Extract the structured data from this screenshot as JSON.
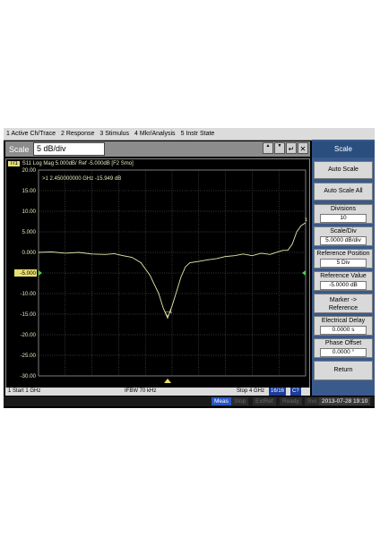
{
  "menu": [
    "1 Active Ch/Trace",
    "2 Response",
    "3 Stimulus",
    "4 Mkr/Analysis",
    "5 Instr State"
  ],
  "entry": {
    "label": "Scale",
    "value": "5 dB/div"
  },
  "entry_controls": {
    "up": "▲",
    "down": "▼",
    "enter": "↵",
    "close": "✕"
  },
  "trace": {
    "badge": "Tr1",
    "header": "S11 Log Mag 5.000dB/ Ref -5.000dB [F2 Smo]"
  },
  "marker": {
    "readout": ">1  2.450000000 GHz -15.949 dB",
    "label": "1"
  },
  "status": {
    "start": "1 Start 1 GHz",
    "ifbw": "IFBW 70 kHz",
    "stop": "Stop 4 GHz",
    "badge1": "16/16",
    "badge2": "C?"
  },
  "bottom": {
    "meas": "Meas",
    "stop": "Stop",
    "ext": "ExtRef",
    "ready": "Ready",
    "svc": "Svc",
    "time": "2013-07-28 19:10"
  },
  "softkeys": {
    "title": "Scale",
    "auto_scale": "Auto Scale",
    "auto_scale_all": "Auto Scale All",
    "divisions_label": "Divisions",
    "divisions_value": "10",
    "scale_div_label": "Scale/Div",
    "scale_div_value": "5.0000 dB/div",
    "ref_pos_label": "Reference Position",
    "ref_pos_value": "5 Div",
    "ref_val_label": "Reference Value",
    "ref_val_value": "-5.0000 dB",
    "marker_ref": "Marker -> Reference",
    "elec_delay_label": "Electrical Delay",
    "elec_delay_value": "0.0000 s",
    "phase_offset_label": "Phase Offset",
    "phase_offset_value": "0.0000 °",
    "return": "Return"
  },
  "chart_data": {
    "type": "line",
    "title": "",
    "xlabel": "",
    "ylabel": "",
    "xlim": [
      1,
      4
    ],
    "ylim": [
      -30,
      20
    ],
    "y_ticks": [
      "20.00",
      "15.00",
      "10.00",
      "5.000",
      "0.000",
      "-5.000",
      "-10.00",
      "-15.00",
      "-20.00",
      "-25.00",
      "-30.00"
    ],
    "grid": true,
    "color": "#e8e8b0",
    "series": [
      {
        "x": [
          1.0,
          1.15,
          1.3,
          1.45,
          1.6,
          1.75,
          1.85,
          1.95,
          2.05,
          2.15,
          2.25,
          2.35,
          2.4,
          2.45,
          2.5,
          2.55,
          2.6,
          2.65,
          2.7,
          2.8,
          2.9,
          3.0,
          3.1,
          3.2,
          3.3,
          3.4,
          3.5,
          3.6,
          3.7,
          3.75,
          3.8,
          3.85,
          3.9,
          3.95,
          4.0
        ],
        "y": [
          0.0,
          0.1,
          -0.2,
          0.0,
          -0.4,
          -0.5,
          -0.3,
          -0.8,
          -1.2,
          -2.5,
          -5.5,
          -10.0,
          -13.5,
          -15.95,
          -13.0,
          -9.5,
          -6.0,
          -3.5,
          -2.5,
          -2.2,
          -1.8,
          -1.5,
          -1.0,
          -0.8,
          -0.4,
          -0.8,
          -0.2,
          -0.5,
          0.2,
          0.5,
          0.5,
          2.0,
          5.0,
          6.5,
          7.2
        ]
      }
    ],
    "markers": [
      {
        "x": 2.45,
        "y": -15.949,
        "label": "1"
      }
    ]
  }
}
